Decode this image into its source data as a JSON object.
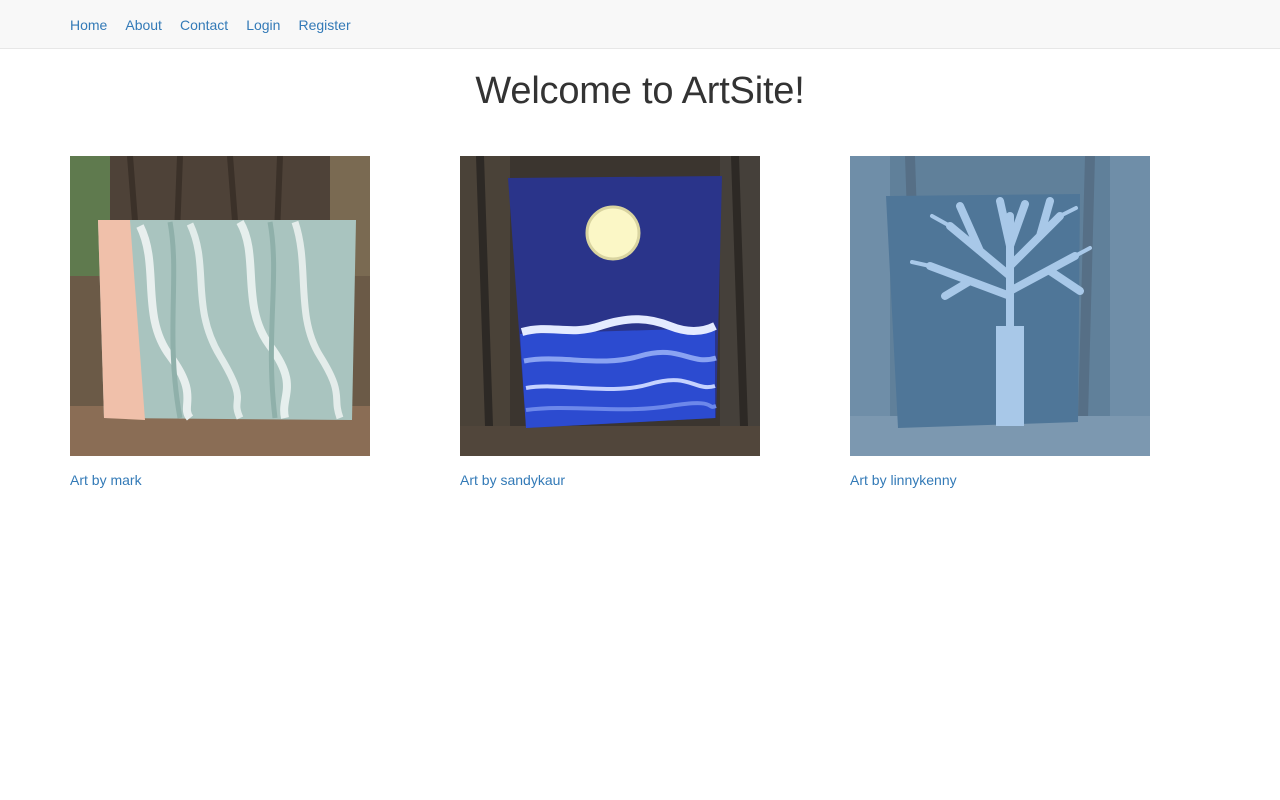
{
  "nav": {
    "items": [
      {
        "label": "Home"
      },
      {
        "label": "About"
      },
      {
        "label": "Contact"
      },
      {
        "label": "Login"
      },
      {
        "label": "Register"
      }
    ]
  },
  "page": {
    "title": "Welcome to ArtSite!"
  },
  "gallery": {
    "items": [
      {
        "caption": "Art by mark",
        "image": "ocean-waves-painting"
      },
      {
        "caption": "Art by sandykaur",
        "image": "moon-over-sea-painting"
      },
      {
        "caption": "Art by linnykenny",
        "image": "bare-tree-painting"
      }
    ]
  },
  "colors": {
    "link": "#337ab7",
    "navbar_bg": "#f8f8f8",
    "title": "#333333"
  }
}
